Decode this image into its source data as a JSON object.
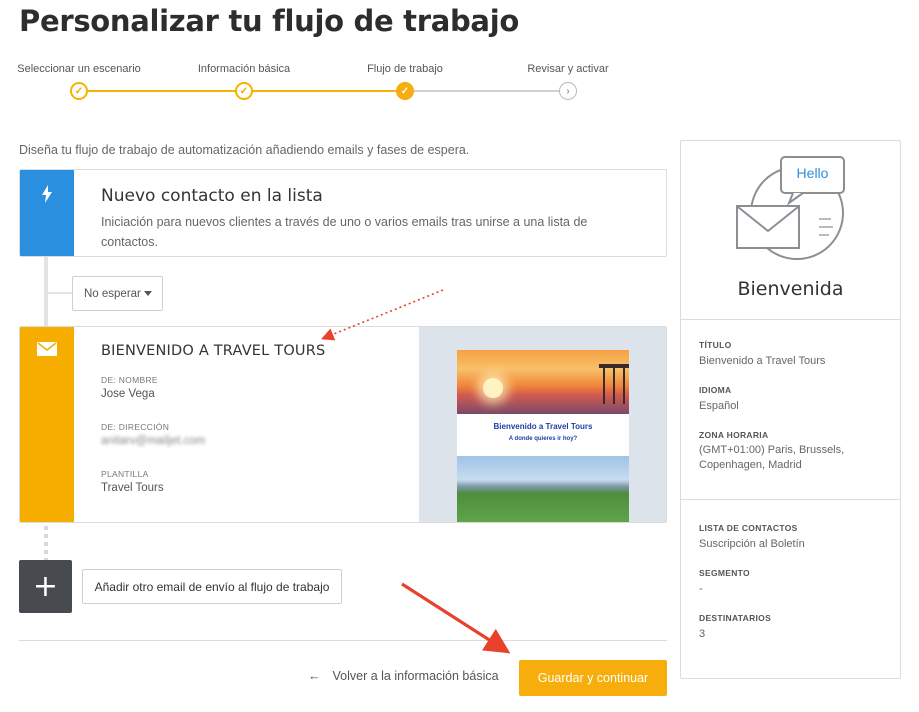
{
  "page": {
    "title": "Personalizar tu flujo de trabajo"
  },
  "stepper": {
    "steps": [
      {
        "label": "Seleccionar un escenario",
        "state": "done"
      },
      {
        "label": "Información básica",
        "state": "done"
      },
      {
        "label": "Flujo de trabajo",
        "state": "current"
      },
      {
        "label": "Revisar y activar",
        "state": "todo"
      }
    ]
  },
  "intro": "Diseña tu flujo de trabajo de automatización añadiendo emails y fases de espera.",
  "trigger": {
    "icon": "lightning-icon",
    "title": "Nuevo contacto en la lista",
    "description": "Iniciación para nuevos clientes a través de uno o varios emails tras unirse a una lista de contactos."
  },
  "wait": {
    "value": "No esperar"
  },
  "email": {
    "icon": "envelope-icon",
    "title": "BIENVENIDO A TRAVEL TOURS",
    "from_name_label": "DE: NOMBRE",
    "from_name": "Jose Vega",
    "from_address_label": "DE: DIRECCIÓN",
    "from_address": "anitarv@mailjet.com",
    "template_label": "PLANTILLA",
    "template": "Travel Tours",
    "preview": {
      "heading": "Bienvenido a Travel Tours",
      "subheading": "A donde quieres ir hoy?"
    }
  },
  "add_email": {
    "button": "+",
    "label": "Añadir otro email de envío al flujo de trabajo"
  },
  "footer": {
    "back_arrow": "←",
    "back_label": "Volver a la información básica",
    "save_label": "Guardar y continuar"
  },
  "side": {
    "bubble_text": "Hello",
    "title": "Bienvenida",
    "fields": [
      {
        "label": "TÍTULO",
        "value": "Bienvenido a Travel Tours"
      },
      {
        "label": "IDIOMA",
        "value": "Español"
      },
      {
        "label": "ZONA HORARIA",
        "value": "(GMT+01:00) Paris, Brussels, Copenhagen, Madrid"
      },
      {
        "label": "LISTA DE CONTACTOS",
        "value": "Suscripción al Boletín"
      },
      {
        "label": "SEGMENTO",
        "value": "-"
      },
      {
        "label": "DESTINATARIOS",
        "value": "3"
      }
    ]
  },
  "colors": {
    "accent": "#f7ad0c",
    "trigger_stripe": "#2b8fe0",
    "email_stripe": "#f7ad00",
    "annotation_arrow": "#e8412c"
  }
}
